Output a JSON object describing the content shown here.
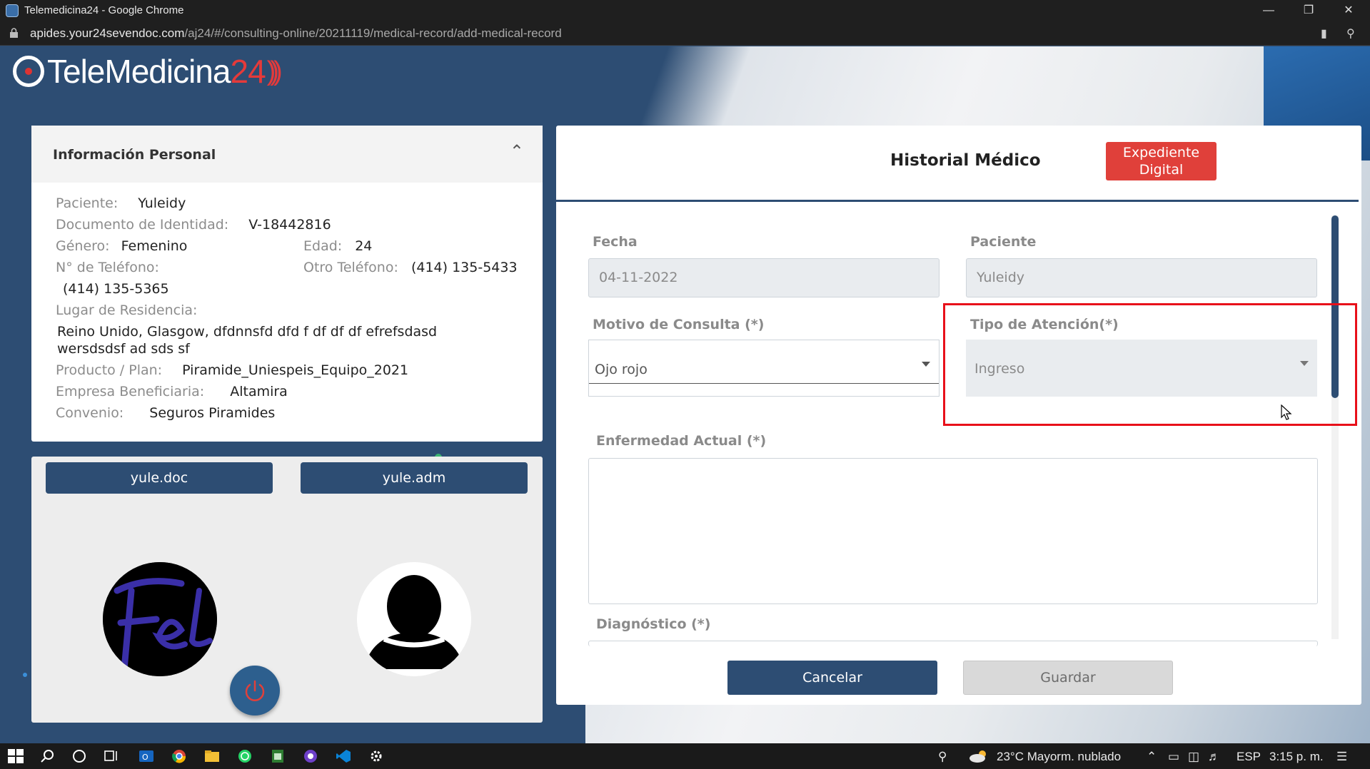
{
  "browser": {
    "window_title": "Telemedicina24 - Google Chrome",
    "url_host": "apides.your24sevendoc.com",
    "url_path": "/aj24/#/consulting-online/20211119/medical-record/add-medical-record"
  },
  "logo": {
    "text": "TeleMedicina",
    "number": "24"
  },
  "personal_info": {
    "title": "Información Personal",
    "patient_label": "Paciente:",
    "patient_value": "Yuleidy",
    "doc_label": "Documento de Identidad:",
    "doc_value": "V-18442816",
    "gender_label": "Género:",
    "gender_value": "Femenino",
    "age_label": "Edad:",
    "age_value": "24",
    "phone_label": "N° de Teléfono:",
    "phone_value": "(414) 135-5365",
    "other_phone_label": "Otro Teléfono:",
    "other_phone_value": "(414) 135-5433",
    "residence_label": "Lugar de Residencia:",
    "residence_line1": "Reino Unido, Glasgow, dfdnnsfd dfd f df df df efrefsdasd",
    "residence_line2": "wersdsdsf ad sds sf",
    "plan_label": "Producto / Plan:",
    "plan_value": "Piramide_Uniespeis_Equipo_2021",
    "company_label": "Empresa Beneficiaria:",
    "company_value": "Altamira",
    "agreement_label": "Convenio:",
    "agreement_value": "Seguros Piramides"
  },
  "users": {
    "doctor_label": "yule.doc",
    "admin_label": "yule.adm"
  },
  "medical_record": {
    "title": "Historial Médico",
    "digital_file_line1": "Expediente",
    "digital_file_line2": "Digital",
    "date_label": "Fecha",
    "date_value": "04-11-2022",
    "patient_label": "Paciente",
    "patient_value": "Yuleidy",
    "reason_label": "Motivo de Consulta (*)",
    "reason_value": "Ojo rojo",
    "attention_label": "Tipo de Atención(*)",
    "attention_value": "Ingreso",
    "illness_label": "Enfermedad Actual (*)",
    "diagnosis_label": "Diagnóstico (*)",
    "cancel_label": "Cancelar",
    "save_label": "Guardar"
  },
  "taskbar": {
    "weather": "23°C Mayorm. nublado",
    "language": "ESP",
    "time": "3:15 p. m."
  },
  "colors": {
    "primary": "#2d4d73",
    "accent": "#e0403a",
    "highlight": "#e8101a"
  }
}
